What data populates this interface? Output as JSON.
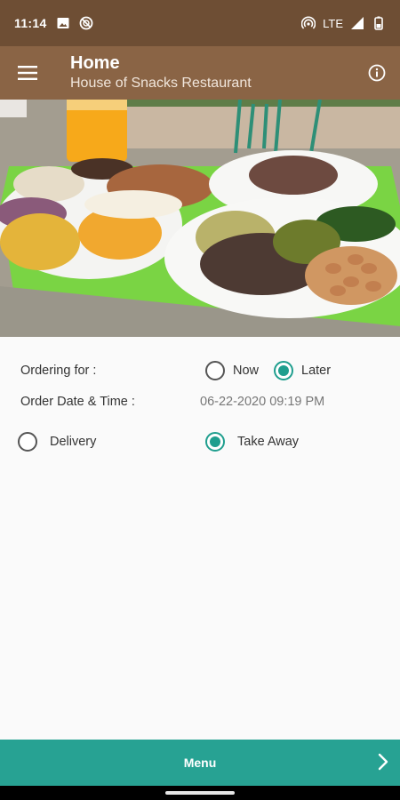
{
  "status_bar": {
    "time": "11:14",
    "network": "LTE"
  },
  "app_bar": {
    "title": "Home",
    "subtitle": "House of Snacks Restaurant"
  },
  "colors": {
    "status_bar": "#6e4e34",
    "app_bar": "#8a6445",
    "accent": "#27a293",
    "radio_checked": "#1f9e8e"
  },
  "icons": {
    "menu": "hamburger-menu-icon",
    "info": "info-icon",
    "next": "chevron-right-icon",
    "status": [
      "image-icon",
      "no-disturb-icon",
      "hotspot-icon",
      "signal-icon",
      "battery-icon"
    ]
  },
  "form": {
    "ordering_for_label": "Ordering for :",
    "ordering_options": {
      "now": "Now",
      "later": "Later",
      "selected": "later"
    },
    "order_datetime_label": "Order Date & Time :",
    "order_datetime_value": "06-22-2020 09:19 PM",
    "fulfillment_options": {
      "delivery": "Delivery",
      "take_away": "Take Away",
      "selected": "take_away"
    }
  },
  "bottom_bar": {
    "label": "Menu"
  }
}
